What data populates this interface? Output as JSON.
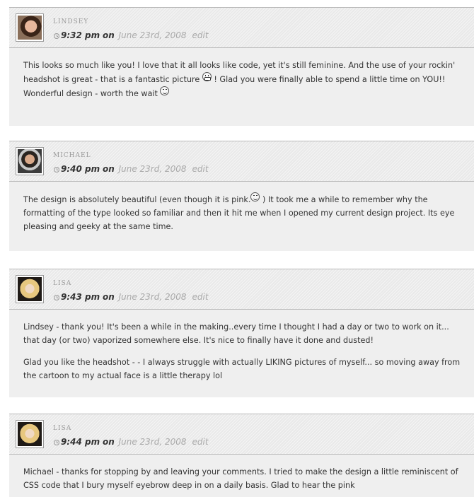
{
  "comments": [
    {
      "author": "Lindsey",
      "time": "9:32 pm",
      "on": "on",
      "date": "June 23rd, 2008",
      "edit": "edit",
      "avatar_icon": "avatar-photo-lindsey",
      "paragraphs": [
        {
          "segments": [
            "This looks so much like you! I love that it all looks like code, yet it's still feminine. And the use of your rockin' headshot is great - that is a fantastic picture ",
            " ! Glad you were finally able to spend a little time on YOU!! Wonderful design - worth the wait "
          ],
          "emoticons": [
            "grin-smiley-icon",
            "wink-smiley-icon"
          ]
        }
      ]
    },
    {
      "author": "Michael",
      "time": "9:40 pm",
      "on": "on",
      "date": "June 23rd, 2008",
      "edit": "edit",
      "avatar_icon": "avatar-photo-michael",
      "paragraphs": [
        {
          "segments": [
            "The design is absolutely beautiful (even though it is pink.",
            " ) It took me a while to remember why the formatting of the type looked so familiar and then it hit me when I opened my current design project. Its eye pleasing and geeky at the same time."
          ],
          "emoticons": [
            "wink-smiley-icon"
          ]
        }
      ]
    },
    {
      "author": "Lisa",
      "time": "9:43 pm",
      "on": "on",
      "date": "June 23rd, 2008",
      "edit": "edit",
      "avatar_icon": "avatar-photo-lisa",
      "paragraphs": [
        {
          "segments": [
            "Lindsey - thank you! It's been a while in the making..every time I thought I had a day or two to work on it... that day (or two) vaporized somewhere else. It's nice to finally have it done and dusted!"
          ],
          "emoticons": []
        },
        {
          "segments": [
            "Glad you like the headshot - - I always struggle with actually LIKING pictures of myself... so moving away from the cartoon to my actual face is a little therapy lol"
          ],
          "emoticons": []
        }
      ]
    },
    {
      "author": "Lisa",
      "time": "9:44 pm",
      "on": "on",
      "date": "June 23rd, 2008",
      "edit": "edit",
      "avatar_icon": "avatar-photo-lisa",
      "paragraphs": [
        {
          "segments": [
            "Michael - thanks for stopping by and leaving your comments. I tried to make the design a little reminiscent of CSS code that I bury myself eyebrow deep in on a daily basis. Glad to hear the pink"
          ],
          "emoticons": []
        }
      ]
    }
  ]
}
